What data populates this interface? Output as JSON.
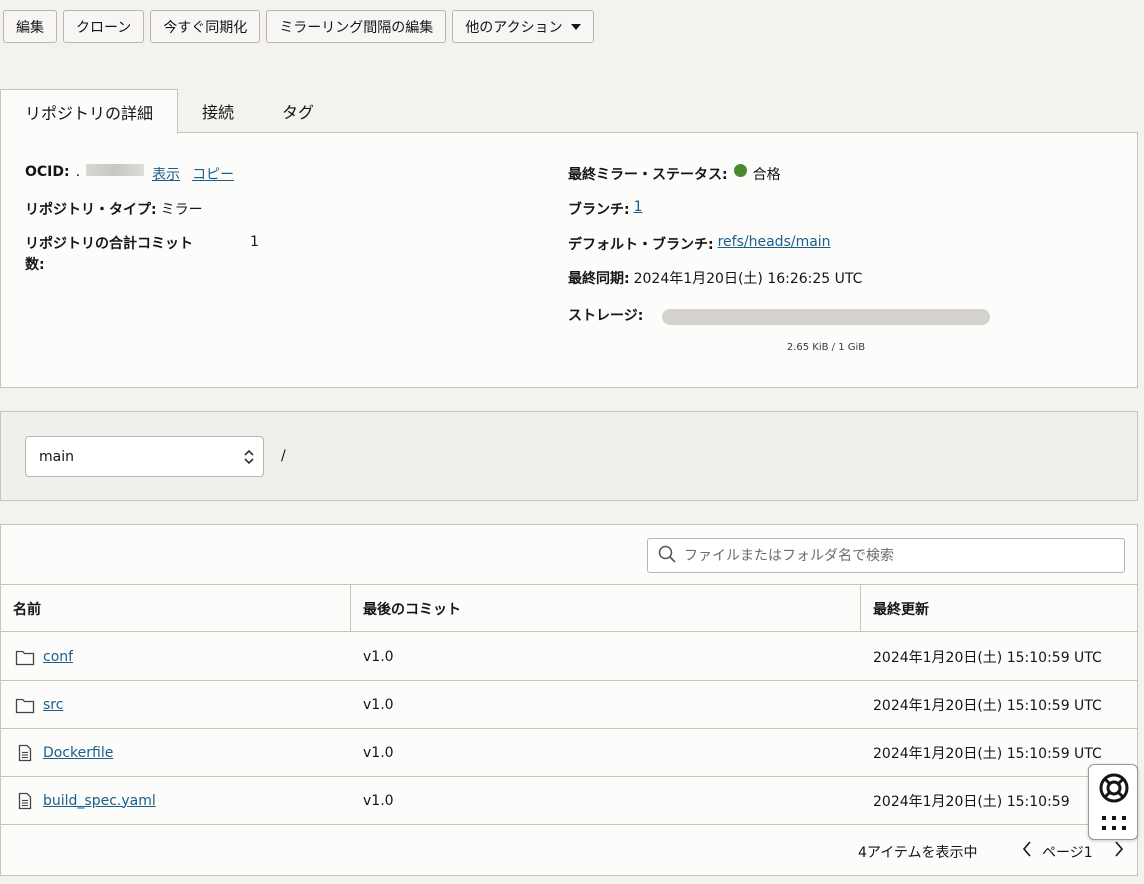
{
  "toolbar": {
    "edit": "編集",
    "clone": "クローン",
    "sync_now": "今すぐ同期化",
    "edit_mirror_interval": "ミラーリング間隔の編集",
    "more_actions": "他のアクション"
  },
  "tabs": [
    {
      "label": "リポジトリの詳細"
    },
    {
      "label": "接続"
    },
    {
      "label": "タグ"
    }
  ],
  "details": {
    "ocid_label": "OCID:",
    "ocid_prefix": ".",
    "show": "表示",
    "copy": "コピー",
    "repo_type_label": "リポジトリ・タイプ:",
    "repo_type_value": "ミラー",
    "commits_label_line1": "リポジトリの合計コミット",
    "commits_label_line2": "数:",
    "commits_value": "1",
    "mirror_status_label": "最終ミラー・ステータス:",
    "mirror_status_value": "合格",
    "branches_label": "ブランチ:",
    "branches_value": "1",
    "default_branch_label": "デフォルト・ブランチ:",
    "default_branch_value": "refs/heads/main",
    "last_sync_label": "最終同期:",
    "last_sync_value": "2024年1月20日(土) 16:26:25 UTC",
    "storage_label": "ストレージ:",
    "storage_text": "2.65 KiB / 1 GiB",
    "storage_fraction": 2.5e-06
  },
  "branch": {
    "selected": "main",
    "path": "/"
  },
  "files": {
    "search_placeholder": "ファイルまたはフォルダ名で検索",
    "columns": {
      "name": "名前",
      "last_commit": "最後のコミット",
      "last_updated": "最終更新"
    },
    "rows": [
      {
        "name": "conf",
        "type": "folder",
        "commit": "v1.0",
        "updated": "2024年1月20日(土) 15:10:59 UTC"
      },
      {
        "name": "src",
        "type": "folder",
        "commit": "v1.0",
        "updated": "2024年1月20日(土) 15:10:59 UTC"
      },
      {
        "name": "Dockerfile",
        "type": "file",
        "commit": "v1.0",
        "updated": "2024年1月20日(土) 15:10:59 UTC"
      },
      {
        "name": "build_spec.yaml",
        "type": "file",
        "commit": "v1.0",
        "updated": "2024年1月20日(土) 15:10:59"
      }
    ],
    "item_count": "4アイテムを表示中",
    "page": "ページ1"
  },
  "colors": {
    "status_ok": "#4a8a2c",
    "link": "#1a5f8a"
  },
  "icons": [
    "caret-down-icon",
    "search-icon",
    "folder-icon",
    "file-icon",
    "chevron-left-icon",
    "chevron-right-icon",
    "help-lifebuoy-icon",
    "apps-grid-icon"
  ]
}
